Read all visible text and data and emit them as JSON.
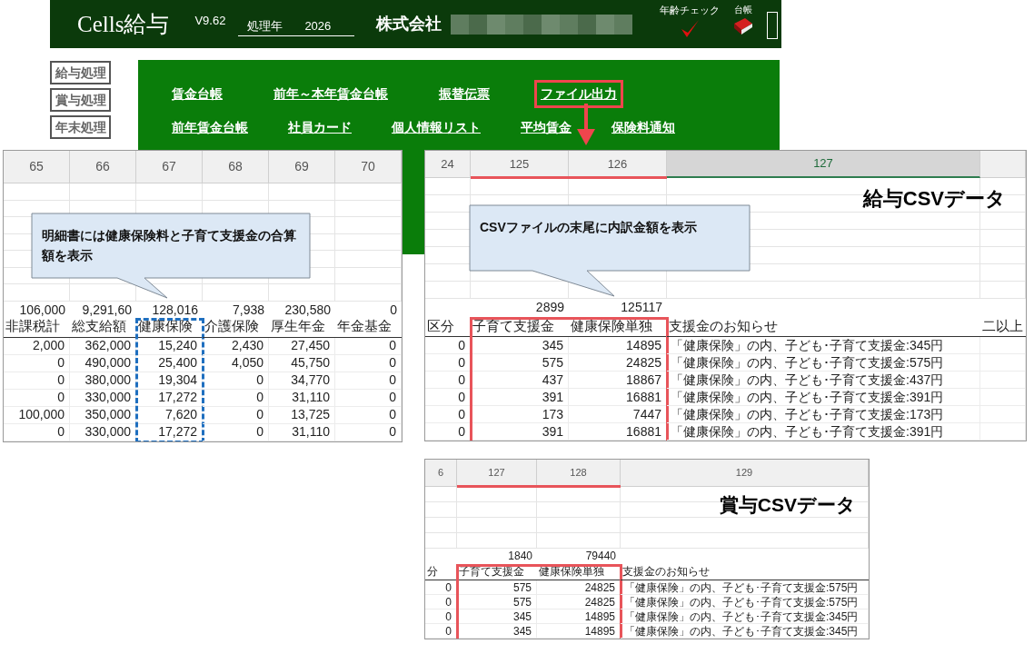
{
  "header": {
    "title": "Cells給与",
    "version": "V9.62",
    "year_label": "処理年",
    "year": "2026",
    "company": "株式会社",
    "age_check": "年齢チェック",
    "ledger": "台帳"
  },
  "sidebar": {
    "items": [
      {
        "label": "給与処理"
      },
      {
        "label": "賞与処理"
      },
      {
        "label": "年末処理"
      }
    ]
  },
  "menu": {
    "rows": [
      [
        {
          "label": "賃金台帳",
          "highlighted": false
        },
        {
          "label": "前年～本年賃金台帳",
          "highlighted": false
        },
        {
          "label": "振替伝票",
          "highlighted": false
        },
        {
          "label": "ファイル出力",
          "highlighted": true
        }
      ],
      [
        {
          "label": "前年賃金台帳",
          "highlighted": false
        },
        {
          "label": "社員カード",
          "highlighted": false
        },
        {
          "label": "個人情報リスト",
          "highlighted": false
        },
        {
          "label": "平均賃金",
          "highlighted": false
        },
        {
          "label": "保険料通知",
          "highlighted": false
        }
      ]
    ]
  },
  "sheets": [
    {
      "kind": "payslip",
      "callout": "明細書には健康保険料と子育て支援金の合算額を表示",
      "groups": [
        {
          "kind": "plain",
          "columns": [
            {
              "label": "65",
              "selected": false,
              "total": "106,000",
              "header": "非課税計",
              "cells": [
                "2,000",
                "0",
                "0",
                "0",
                "100,000",
                "0"
              ]
            },
            {
              "label": "66",
              "selected": false,
              "total": "9,291,60",
              "header": "総支給額",
              "cells": [
                "362,000",
                "490,000",
                "380,000",
                "330,000",
                "350,000",
                "330,000"
              ]
            }
          ]
        },
        {
          "kind": "framed",
          "columns": [
            {
              "label": "67",
              "selected": false,
              "total": "128,016",
              "header": "健康保険",
              "cells": [
                "15,240",
                "25,400",
                "19,304",
                "17,272",
                "7,620",
                "17,272"
              ]
            }
          ]
        },
        {
          "kind": "plain",
          "columns": [
            {
              "label": "68",
              "selected": false,
              "total": "7,938",
              "header": "介護保険",
              "cells": [
                "2,430",
                "4,050",
                "0",
                "0",
                "0",
                "0"
              ]
            },
            {
              "label": "69",
              "selected": false,
              "total": "230,580",
              "header": "厚生年金",
              "cells": [
                "27,450",
                "45,750",
                "34,770",
                "31,110",
                "13,725",
                "31,110"
              ]
            },
            {
              "label": "70",
              "selected": false,
              "total": "0",
              "header": "年金基金",
              "cells": [
                "0",
                "0",
                "0",
                "0",
                "0",
                "0"
              ]
            }
          ]
        }
      ]
    },
    {
      "kind": "csv",
      "title": "給与CSVデータ",
      "callout": "CSVファイルの末尾に内訳金額を表示",
      "groups": [
        {
          "kind": "plain",
          "columns": [
            {
              "label": "24",
              "selected": false,
              "header": "区分",
              "cells": [
                "0",
                "0",
                "0",
                "0",
                "0",
                "0"
              ]
            }
          ]
        },
        {
          "kind": "framed",
          "columns": [
            {
              "label": "125",
              "selected": false,
              "total": "2899",
              "header": "子育て支援金",
              "cells": [
                "345",
                "575",
                "437",
                "391",
                "173",
                "391"
              ]
            },
            {
              "label": "126",
              "selected": false,
              "total": "125117",
              "header": "健康保険単独",
              "cells": [
                "14895",
                "24825",
                "18867",
                "16881",
                "7447",
                "16881"
              ]
            }
          ]
        },
        {
          "kind": "plain",
          "columns": [
            {
              "label": "127",
              "selected": true,
              "header": "支援金のお知らせ",
              "cells": [
                "「健康保険」の内、子ども･子育て支援金:345円",
                "「健康保険」の内、子ども･子育て支援金:575円",
                "「健康保険」の内、子ども･子育て支援金:437円",
                "「健康保険」の内、子ども･子育て支援金:391円",
                "「健康保険」の内、子ども･子育て支援金:173円",
                "「健康保険」の内、子ども･子育て支援金:391円"
              ]
            },
            {
              "selected": false,
              "header": "二以上"
            }
          ]
        }
      ]
    },
    {
      "kind": "csv",
      "title": "賞与CSVデータ",
      "groups": [
        {
          "kind": "plain",
          "columns": [
            {
              "label": "6",
              "selected": false,
              "header": "分",
              "cells": [
                "0",
                "0",
                "0",
                "0"
              ]
            }
          ]
        },
        {
          "kind": "framed",
          "columns": [
            {
              "label": "127",
              "selected": false,
              "total": "1840",
              "header": "子育て支援金",
              "cells": [
                "575",
                "575",
                "345",
                "345"
              ]
            },
            {
              "label": "128",
              "selected": false,
              "total": "79440",
              "header": "健康保険単独",
              "cells": [
                "24825",
                "24825",
                "14895",
                "14895"
              ]
            }
          ]
        },
        {
          "kind": "plain",
          "columns": [
            {
              "label": "129",
              "selected": false,
              "header": "支援金のお知らせ",
              "cells": [
                "「健康保険」の内、子ども･子育て支援金:575円",
                "「健康保険」の内、子ども･子育て支援金:575円",
                "「健康保険」の内、子ども･子育て支援金:345円",
                "「健康保険」の内、子ども･子育て支援金:345円"
              ]
            }
          ]
        }
      ]
    }
  ]
}
